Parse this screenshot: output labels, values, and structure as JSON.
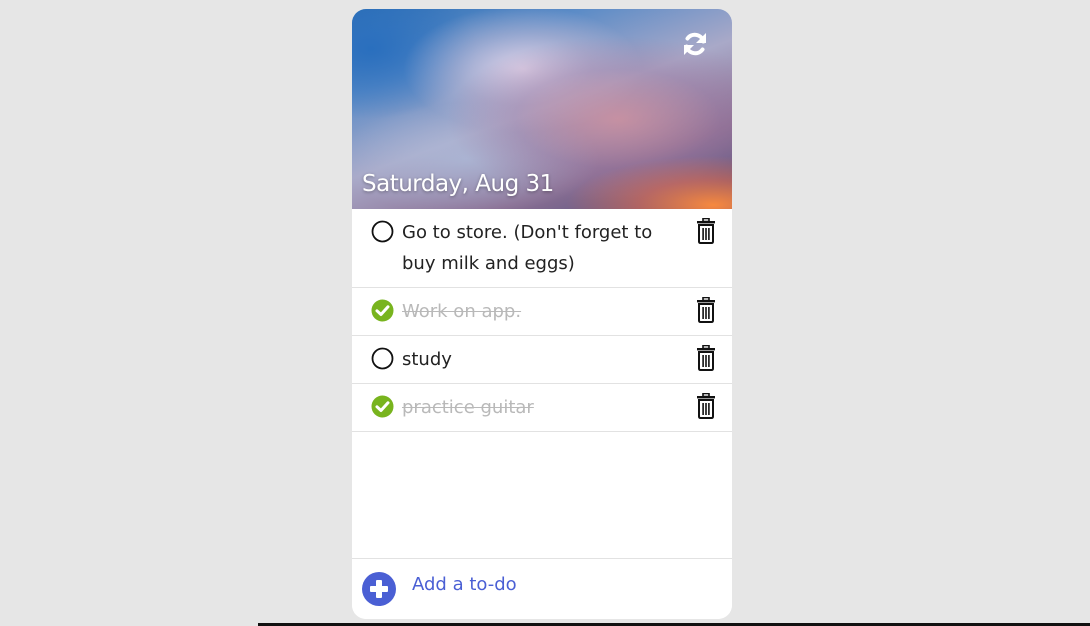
{
  "header": {
    "date": "Saturday, Aug 31",
    "refresh_icon": "refresh-icon"
  },
  "todos": [
    {
      "text": "Go to store. (Don't forget to buy milk and eggs)",
      "done": false
    },
    {
      "text": "Work on app.",
      "done": true
    },
    {
      "text": "study",
      "done": false
    },
    {
      "text": "practice guitar",
      "done": true
    }
  ],
  "footer": {
    "add_label": "Add a to-do",
    "add_icon": "plus-circle-icon"
  },
  "colors": {
    "accent": "#4a5fd4",
    "done_check": "#78b41e",
    "done_text": "#b9b9b9",
    "background": "#e6e6e6"
  }
}
